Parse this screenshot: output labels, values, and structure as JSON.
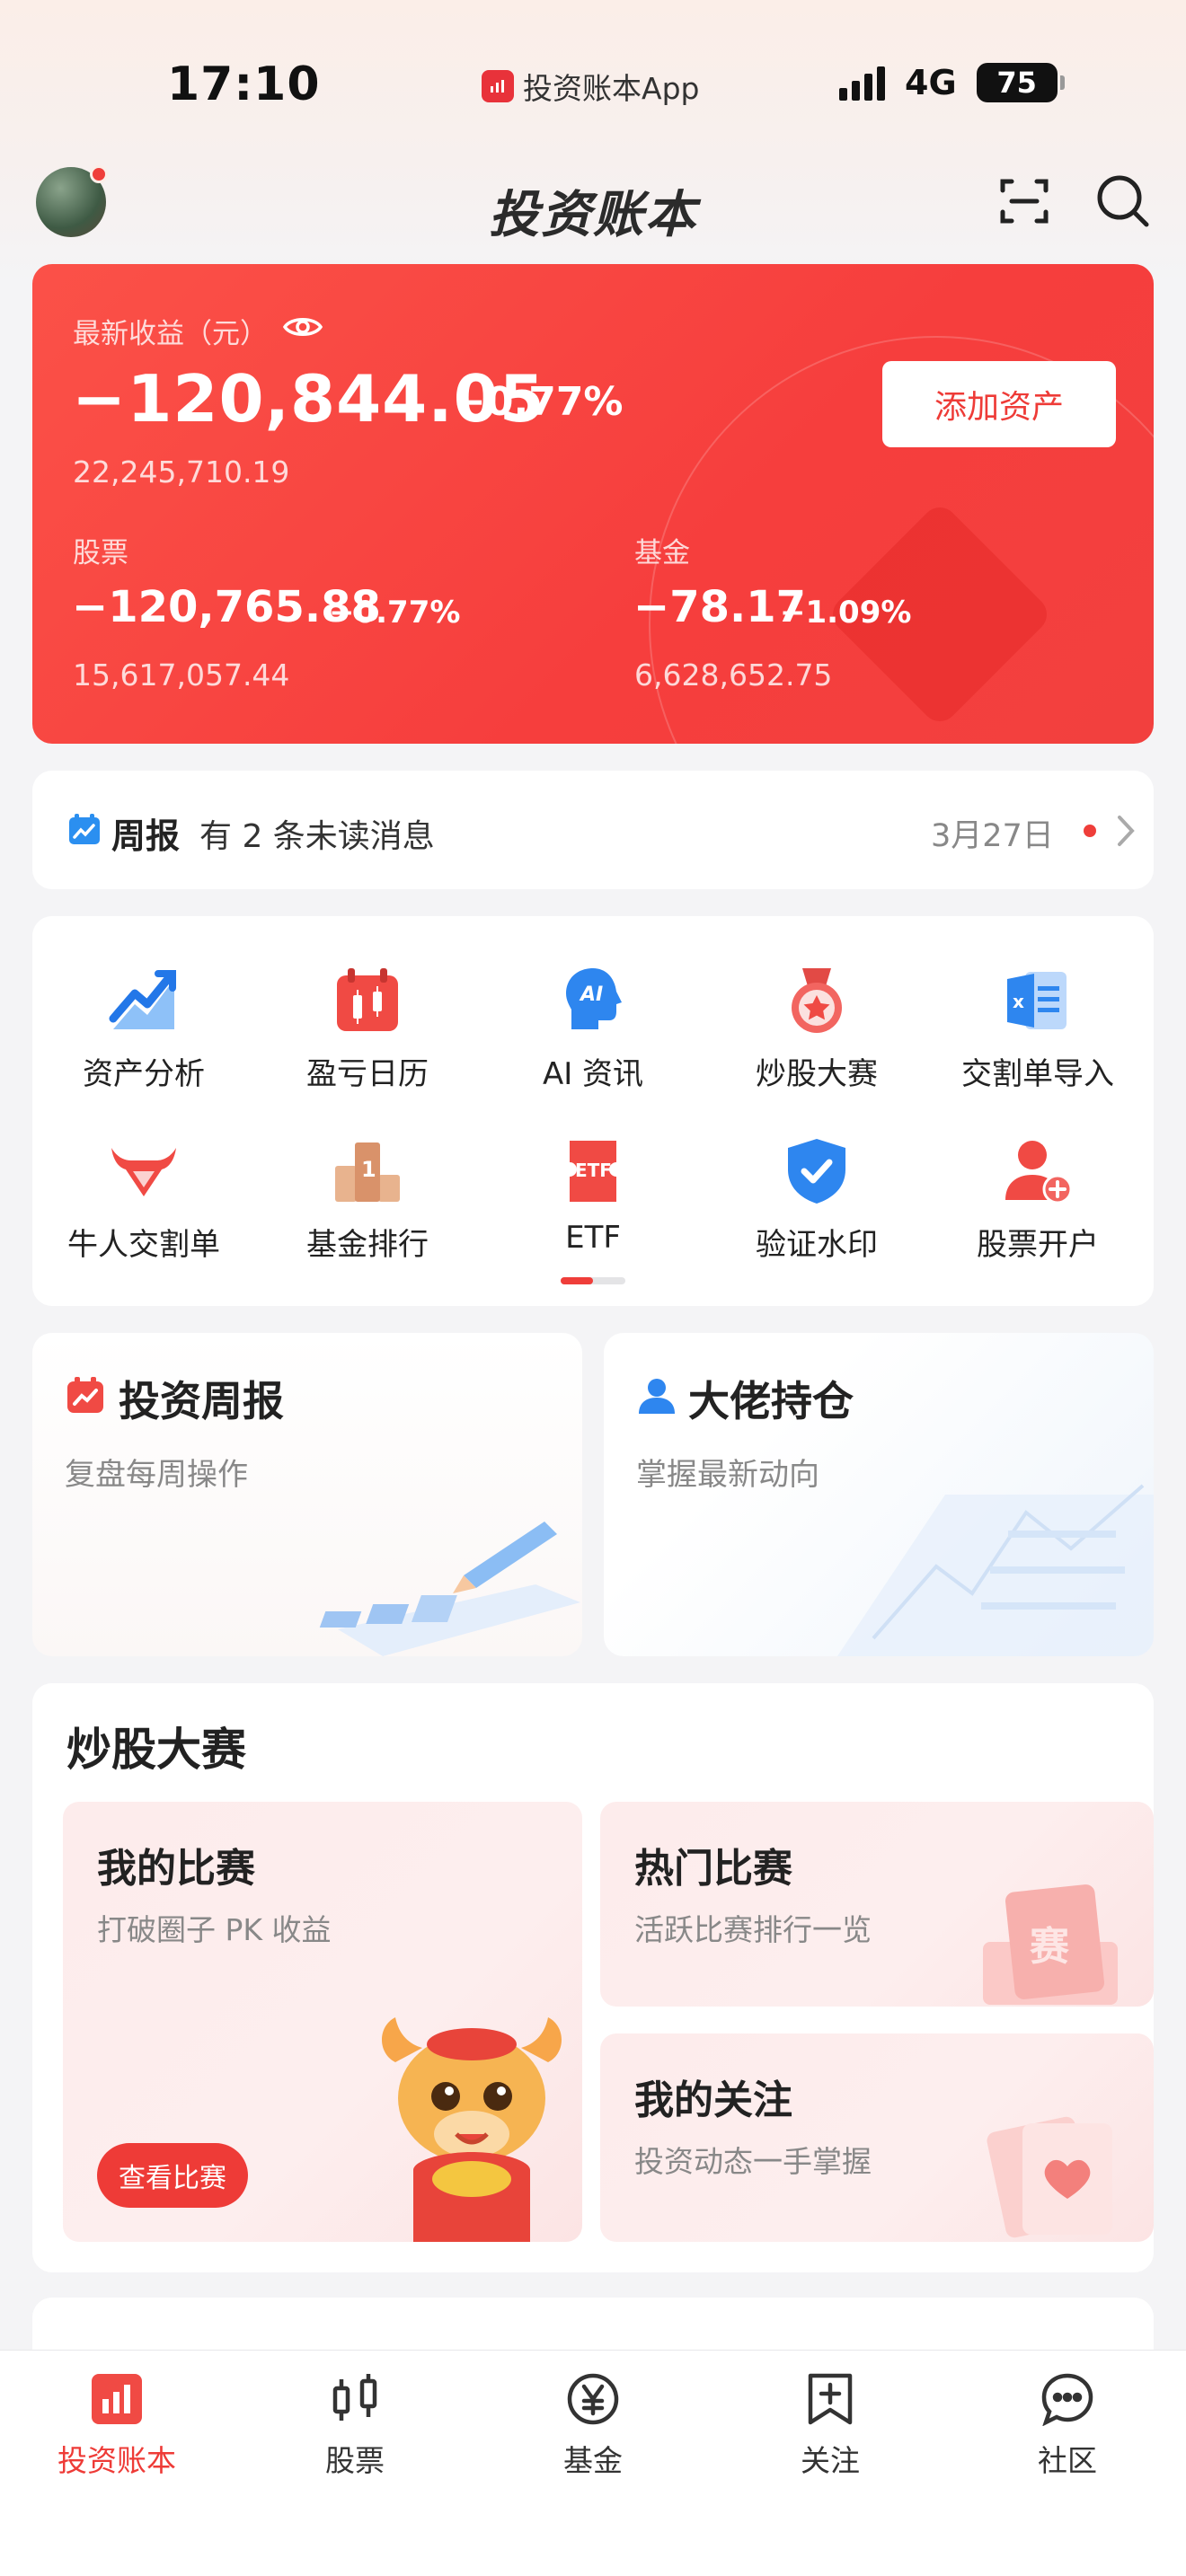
{
  "status_bar": {
    "time": "17:10",
    "app_name": "投资账本App",
    "network": "4G",
    "battery": "75"
  },
  "header": {
    "title": "投资账本",
    "scan_icon": "scan-icon",
    "search_icon": "search-icon"
  },
  "portfolio": {
    "label": "最新收益（元）",
    "total_profit": "−120,844.05",
    "total_pct": "−0.77%",
    "total_value": "22,245,710.19",
    "add_button": "添加资产",
    "stock": {
      "label": "股票",
      "profit": "−120,765.88",
      "pct": "−0.77%",
      "value": "15,617,057.44"
    },
    "fund": {
      "label": "基金",
      "profit": "−78.17",
      "pct": "−1.09%",
      "value": "6,628,652.75"
    }
  },
  "notice": {
    "title": "周报",
    "message": "有 2 条未读消息",
    "date": "3月27日"
  },
  "shortcuts": [
    {
      "label": "资产分析",
      "icon": "chart-trend-icon"
    },
    {
      "label": "盈亏日历",
      "icon": "calendar-candle-icon"
    },
    {
      "label": "AI 资讯",
      "icon": "ai-head-icon"
    },
    {
      "label": "炒股大赛",
      "icon": "medal-icon"
    },
    {
      "label": "交割单导入",
      "icon": "excel-import-icon"
    },
    {
      "label": "牛人交割单",
      "icon": "bull-icon"
    },
    {
      "label": "基金排行",
      "icon": "ranking-icon"
    },
    {
      "label": "ETF",
      "icon": "etf-ticket-icon"
    },
    {
      "label": "验证水印",
      "icon": "verify-shield-icon"
    },
    {
      "label": "股票开户",
      "icon": "user-add-icon"
    }
  ],
  "promos": [
    {
      "title": "投资周报",
      "subtitle": "复盘每周操作"
    },
    {
      "title": "大佬持仓",
      "subtitle": "掌握最新动向"
    }
  ],
  "contest": {
    "title": "炒股大赛",
    "my": {
      "title": "我的比赛",
      "subtitle": "打破圈子 PK 收益",
      "button": "查看比赛"
    },
    "hot": {
      "title": "热门比赛",
      "subtitle": "活跃比赛排行一览"
    },
    "follow": {
      "title": "我的关注",
      "subtitle": "投资动态一手掌握"
    }
  },
  "tabs": [
    {
      "label": "投资账本",
      "icon": "ledger-icon",
      "active": true
    },
    {
      "label": "股票",
      "icon": "candlestick-icon",
      "active": false
    },
    {
      "label": "基金",
      "icon": "yen-circle-icon",
      "active": false
    },
    {
      "label": "关注",
      "icon": "bookmark-plus-icon",
      "active": false
    },
    {
      "label": "社区",
      "icon": "chat-bubble-icon",
      "active": false
    }
  ],
  "colors": {
    "accent": "#EE3B37",
    "card_start": "#FB5148",
    "card_end": "#F2403E"
  }
}
